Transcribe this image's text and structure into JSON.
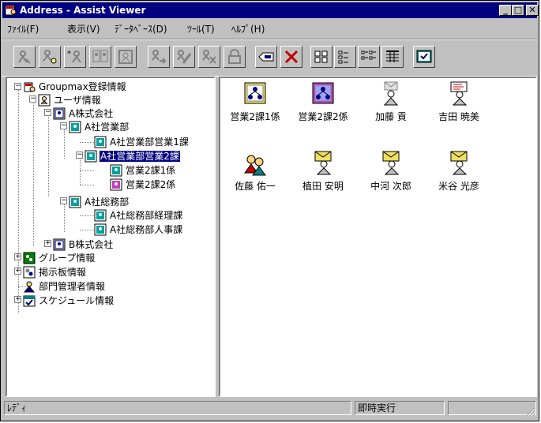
{
  "window": {
    "title": "Address - Assist Viewer",
    "controls": {
      "minimize": "_",
      "maximize": "□",
      "close": "✕"
    }
  },
  "menu": [
    {
      "label": "ﾌｧｲﾙ(F)"
    },
    {
      "label": "表示(V)"
    },
    {
      "label": "ﾃﾞｰﾀﾍﾞｰｽ(D)"
    },
    {
      "label": "ﾂｰﾙ(T)"
    },
    {
      "label": "ﾍﾙﾌﾟ(H)"
    }
  ],
  "toolbar": [
    "search-user-icon",
    "search-group-icon",
    "new-user-icon",
    "copy-user-icon",
    "address-book-icon",
    "move-user-icon",
    "edit-user-icon",
    "delete-user-icon",
    "lock-icon",
    "send-mail-icon",
    "delete-icon",
    "large-icons-view-icon",
    "small-icons-view-icon",
    "list-view-icon",
    "details-view-icon",
    "execute-icon"
  ],
  "tree": {
    "root": "Groupmax登録情報",
    "user_info": "ユーザ情報",
    "company_a": "A株式会社",
    "sales_dept": "A社営業部",
    "sales_sec1": "A社営業部営業1課",
    "sales_sec2": "A社営業部営業2課",
    "sales2_unit1": "営業2課1係",
    "sales2_unit2": "営業2課2係",
    "admin_dept": "A社総務部",
    "accounting": "A社総務部経理課",
    "hr": "A社総務部人事課",
    "company_b": "B株式会社",
    "group_info": "グループ情報",
    "bulletin_info": "掲示板情報",
    "dept_admin_info": "部門管理者情報",
    "schedule_info": "スケジュール情報"
  },
  "list": [
    {
      "label": "営業2課1係",
      "icon": "org-unit-icon"
    },
    {
      "label": "営業2課2係",
      "icon": "org-unit-pink-icon"
    },
    {
      "label": "加藤 貢",
      "icon": "user-gray-mail-icon"
    },
    {
      "label": "吉田 暁美",
      "icon": "user-red-mail-icon"
    },
    {
      "label": "佐藤 佑一",
      "icon": "manager-user-icon"
    },
    {
      "label": "植田 安明",
      "icon": "user-mail-icon"
    },
    {
      "label": "中河 次郎",
      "icon": "user-mail-icon"
    },
    {
      "label": "米谷 光彦",
      "icon": "user-mail-icon"
    }
  ],
  "status": {
    "left": "ﾚﾃﾞｨ",
    "mode": "即時実行",
    "extra": ""
  },
  "colors": {
    "title_bar": "#000080",
    "face": "#c0c0c0",
    "selection": "#000080",
    "envelope": "#f0e060"
  }
}
